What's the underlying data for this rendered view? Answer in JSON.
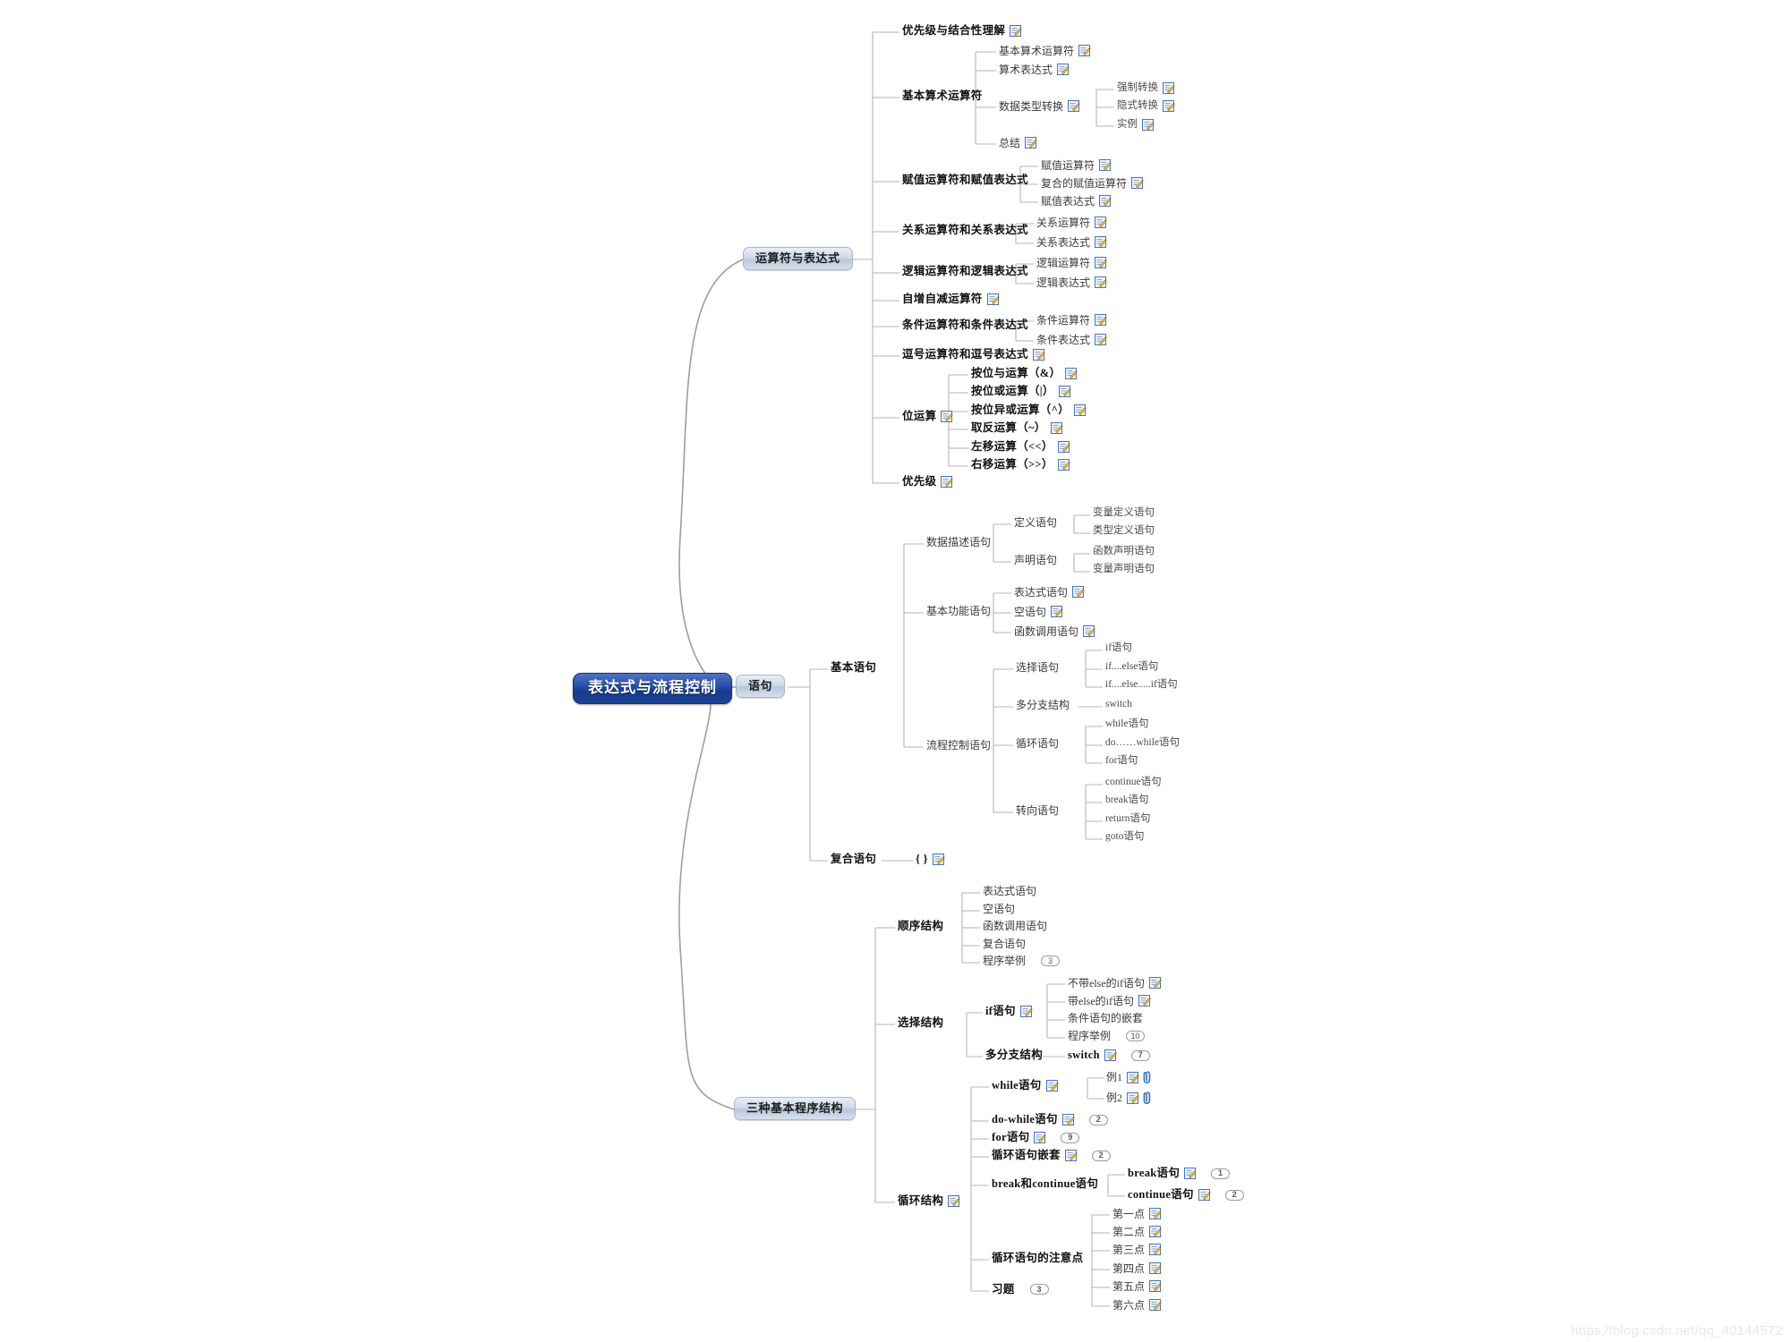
{
  "watermark": "https://blog.csdn.net/qq_40144572",
  "root": {
    "label": "表达式与流程控制"
  },
  "branches": [
    {
      "id": "b1",
      "label": "运算符与表达式"
    },
    {
      "id": "b2",
      "label": "语句"
    },
    {
      "id": "b3",
      "label": "三种基本程序结构"
    }
  ],
  "icons": {
    "note": "note-edit-icon",
    "clip": "attachment-icon"
  },
  "operators": {
    "items": [
      {
        "label": "优先级与结合性理解",
        "note": true
      },
      {
        "label": "基本算术运算符",
        "note": false
      },
      {
        "label": "赋值运算符和赋值表达式",
        "note": false
      },
      {
        "label": "关系运算符和关系表达式",
        "note": false
      },
      {
        "label": "逻辑运算符和逻辑表达式",
        "note": false
      },
      {
        "label": "自增自减运算符",
        "note": true
      },
      {
        "label": "条件运算符和条件表达式",
        "note": false
      },
      {
        "label": "逗号运算符和逗号表达式",
        "note": true
      },
      {
        "label": "位运算",
        "note": true
      },
      {
        "label": "优先级",
        "note": true
      }
    ],
    "arithmetic_children": [
      {
        "label": "基本算术运算符",
        "note": true
      },
      {
        "label": "算术表达式",
        "note": true
      },
      {
        "label": "数据类型转换",
        "note": true
      },
      {
        "label": "总结",
        "note": true
      }
    ],
    "conversion_children": [
      {
        "label": "强制转换",
        "note": true
      },
      {
        "label": "隐式转换",
        "note": true
      },
      {
        "label": "实例",
        "note": true
      }
    ],
    "assignment_children": [
      {
        "label": "赋值运算符",
        "note": true
      },
      {
        "label": "复合的赋值运算符",
        "note": true
      },
      {
        "label": "赋值表达式",
        "note": true
      }
    ],
    "relational_children": [
      {
        "label": "关系运算符",
        "note": true
      },
      {
        "label": "关系表达式",
        "note": true
      }
    ],
    "logical_children": [
      {
        "label": "逻辑运算符",
        "note": true
      },
      {
        "label": "逻辑表达式",
        "note": true
      }
    ],
    "conditional_children": [
      {
        "label": "条件运算符",
        "note": true
      },
      {
        "label": "条件表达式",
        "note": true
      }
    ],
    "bitwise_children": [
      {
        "label": "按位与运算（&）",
        "note": true
      },
      {
        "label": "按位或运算（|）",
        "note": true
      },
      {
        "label": "按位异或运算（^）",
        "note": true
      },
      {
        "label": "取反运算（~）",
        "note": true
      },
      {
        "label": "左移运算（<<）",
        "note": true
      },
      {
        "label": "右移运算（>>）",
        "note": true
      }
    ]
  },
  "statements": {
    "items": [
      {
        "label": "基本语句"
      },
      {
        "label": "复合语句"
      }
    ],
    "compound_child": {
      "label": "{  }",
      "note": true
    },
    "basic_children": [
      {
        "label": "数据描述语句"
      },
      {
        "label": "基本功能语句"
      },
      {
        "label": "流程控制语句"
      }
    ],
    "data_desc_children": [
      {
        "label": "定义语句"
      },
      {
        "label": "声明语句"
      }
    ],
    "define_children": [
      {
        "label": "变量定义语句"
      },
      {
        "label": "类型定义语句"
      }
    ],
    "declare_children": [
      {
        "label": "函数声明语句"
      },
      {
        "label": "变量声明语句"
      }
    ],
    "basic_func_children": [
      {
        "label": "表达式语句",
        "note": true
      },
      {
        "label": "空语句",
        "note": true
      },
      {
        "label": "函数调用语句",
        "note": true
      }
    ],
    "flow_children": [
      {
        "label": "选择语句"
      },
      {
        "label": "多分支结构"
      },
      {
        "label": "循环语句"
      },
      {
        "label": "转向语句"
      }
    ],
    "select_children": [
      {
        "label": "if语句"
      },
      {
        "label": "if....else语句"
      },
      {
        "label": "if....else.....if语句"
      }
    ],
    "multi_children": [
      {
        "label": "switch"
      }
    ],
    "loop_children": [
      {
        "label": "while语句"
      },
      {
        "label": "do……while语句"
      },
      {
        "label": "for语句"
      }
    ],
    "jump_children": [
      {
        "label": "continue语句"
      },
      {
        "label": "break语句"
      },
      {
        "label": "return语句"
      },
      {
        "label": "goto语句"
      }
    ]
  },
  "structures": {
    "items": [
      {
        "label": "顺序结构",
        "note": false
      },
      {
        "label": "选择结构",
        "note": false
      },
      {
        "label": "循环结构",
        "note": true
      }
    ],
    "sequence_children": [
      {
        "label": "表达式语句",
        "badge": null
      },
      {
        "label": "空语句",
        "badge": null
      },
      {
        "label": "函数调用语句",
        "badge": null
      },
      {
        "label": "复合语句",
        "badge": null
      },
      {
        "label": "程序举例",
        "badge": "3"
      }
    ],
    "selection_children": [
      {
        "label": "if语句",
        "note": true
      },
      {
        "label": "多分支结构",
        "note": false
      }
    ],
    "if_children": [
      {
        "label": "不带else的if语句",
        "note": true,
        "badge": null
      },
      {
        "label": "带else的if语句",
        "note": true,
        "badge": null
      },
      {
        "label": "条件语句的嵌套",
        "note": false,
        "badge": null
      },
      {
        "label": "程序举例",
        "note": false,
        "badge": "10"
      }
    ],
    "multi_children": [
      {
        "label": "switch",
        "note": true,
        "badge": "7"
      }
    ],
    "loop_children": [
      {
        "label": "while语句",
        "note": true,
        "badge": null
      },
      {
        "label": "do-while语句",
        "note": true,
        "badge": "2"
      },
      {
        "label": "for语句",
        "note": true,
        "badge": "9"
      },
      {
        "label": "循环语句嵌套",
        "note": true,
        "badge": "2"
      },
      {
        "label": "break和continue语句",
        "note": false,
        "badge": null
      },
      {
        "label": "循环语句的注意点",
        "note": false,
        "badge": null
      },
      {
        "label": "习题",
        "note": false,
        "badge": "3"
      }
    ],
    "while_children": [
      {
        "label": "例1",
        "note": true,
        "clip": true
      },
      {
        "label": "例2",
        "note": true,
        "clip": true
      }
    ],
    "break_continue_children": [
      {
        "label": "break语句",
        "note": true,
        "badge": "1"
      },
      {
        "label": "continue语句",
        "note": true,
        "badge": "2"
      }
    ],
    "notes_children": [
      {
        "label": "第一点",
        "note": true
      },
      {
        "label": "第二点",
        "note": true
      },
      {
        "label": "第三点",
        "note": true
      },
      {
        "label": "第四点",
        "note": true
      },
      {
        "label": "第五点",
        "note": true
      },
      {
        "label": "第六点",
        "note": true
      }
    ]
  }
}
